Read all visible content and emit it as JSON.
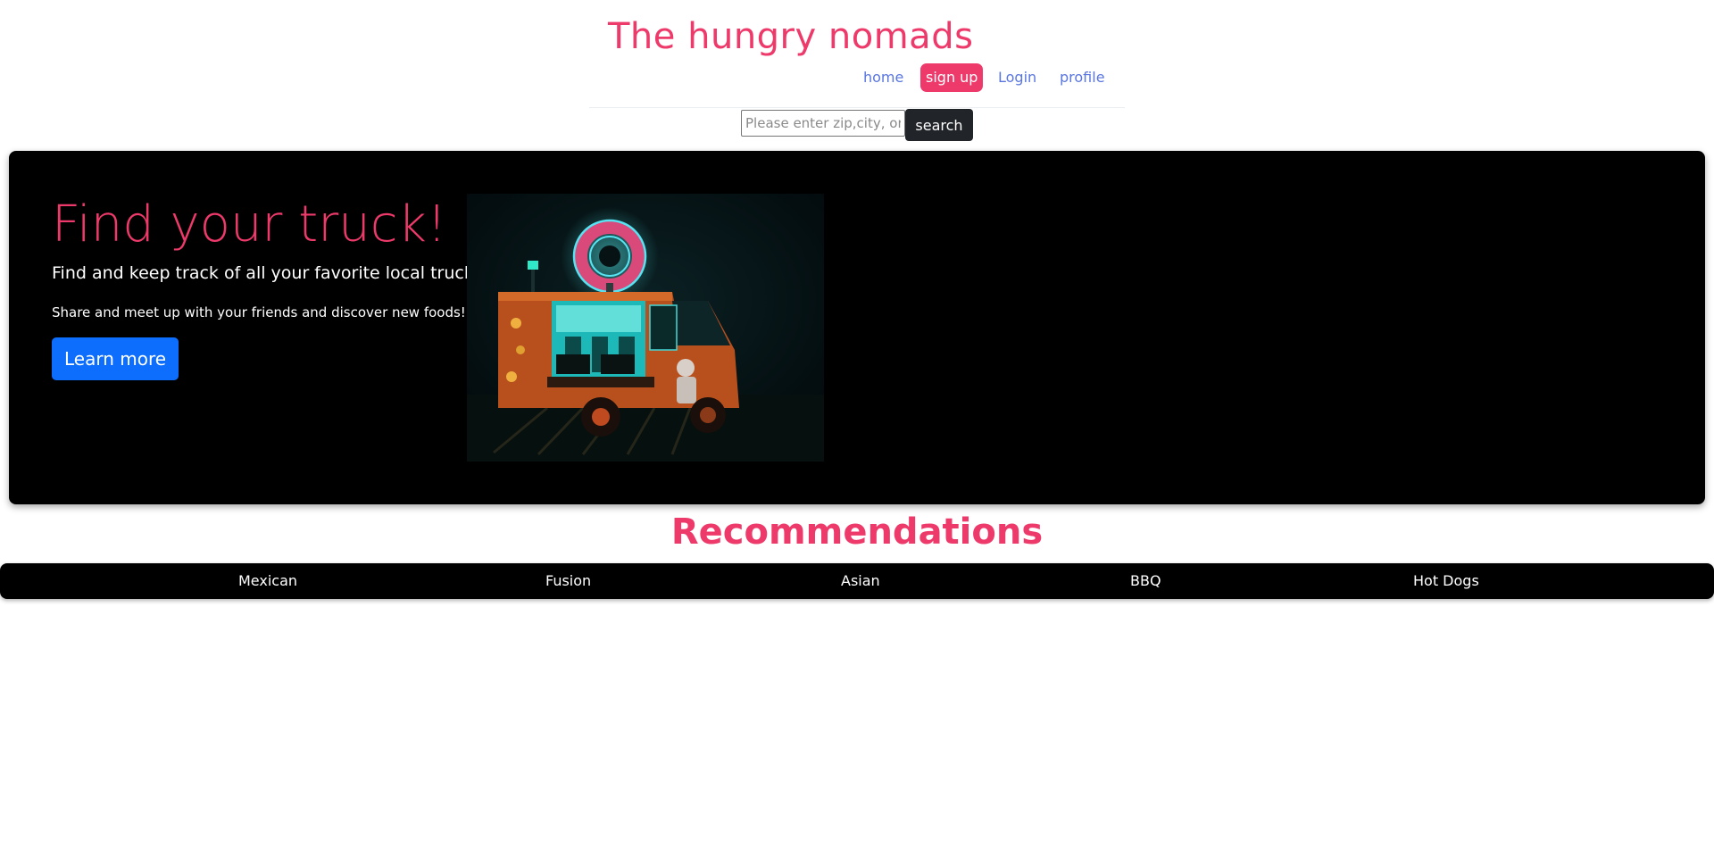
{
  "header": {
    "brand": "The hungry nomads",
    "nav": {
      "home": "home",
      "signup": "sign up",
      "login": "Login",
      "profile": "profile"
    }
  },
  "search": {
    "placeholder": "Please enter zip,city, or state",
    "value": "",
    "button": "search"
  },
  "hero": {
    "title": "Find your truck!",
    "lead": "Find and keep track of all your favorite local trucks!",
    "sub": "Share and meet up with your friends and discover new foods!",
    "button": "Learn more"
  },
  "recommendations": {
    "title": "Recommendations",
    "categories": [
      "Mexican",
      "Fusion",
      "Asian",
      "BBQ",
      "Hot Dogs"
    ]
  },
  "colors": {
    "brand_pink": "#ee3a6a",
    "nav_link": "#5a76e0",
    "primary_button": "#0d6efd",
    "dark": "#212529"
  }
}
